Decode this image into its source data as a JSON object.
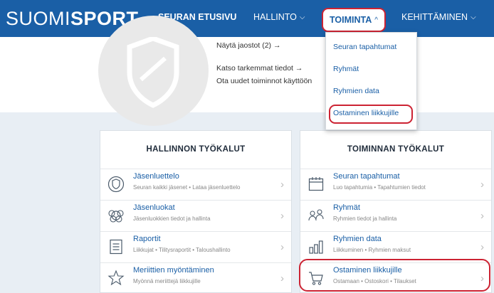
{
  "topnav": {
    "logo_light": "SUOMI",
    "logo_bold": "SPORT",
    "items": [
      {
        "label": "SEURAN ETUSIVU"
      },
      {
        "label": "HALLINTO"
      },
      {
        "label": "TOIMINTA"
      },
      {
        "label": "KEHITTÄMINEN"
      }
    ]
  },
  "header": {
    "links": [
      "Näytä jaostot (2) →",
      "Katso tarkemmat tiedot →",
      "Ota uudet toiminnot käyttöön"
    ]
  },
  "dropdown": {
    "items": [
      "Seuran tapahtumat",
      "Ryhmät",
      "Ryhmien data",
      "Ostaminen liikkujille"
    ]
  },
  "left_panel": {
    "title": "HALLINNON TYÖKALUT",
    "rows": [
      {
        "title": "Jäsenluettelo",
        "subtitle": "Seuran kaikki jäsenet • Lataa jäsenluettelo",
        "icon": "member-shield-icon"
      },
      {
        "title": "Jäsenluokat",
        "subtitle": "Jäsenluokkien tiedot ja hallinta",
        "icon": "member-classes-icon"
      },
      {
        "title": "Raportit",
        "subtitle": "Liikkujat • Tilitysraportit • Taloushallinto",
        "icon": "report-icon"
      },
      {
        "title": "Meriittien myöntäminen",
        "subtitle": "Myönnä meriittejä liikkujille",
        "icon": "star-icon"
      }
    ]
  },
  "right_panel": {
    "title": "TOIMINNAN TYÖKALUT",
    "rows": [
      {
        "title": "Seuran tapahtumat",
        "subtitle": "Luo tapahtumia • Tapahtumien tiedot",
        "icon": "calendar-icon"
      },
      {
        "title": "Ryhmät",
        "subtitle": "Ryhmien tiedot ja hallinta",
        "icon": "group-icon"
      },
      {
        "title": "Ryhmien data",
        "subtitle": "Liikkuminen • Ryhmien maksut",
        "icon": "bar-chart-icon"
      },
      {
        "title": "Ostaminen liikkujille",
        "subtitle": "Ostamaan • Ostoskori • Tilaukset",
        "icon": "shopping-cart-icon"
      }
    ]
  },
  "colors": {
    "brand_blue": "#1a5fa6",
    "highlight_red": "#cc2333",
    "page_bg": "#e8eef4"
  }
}
